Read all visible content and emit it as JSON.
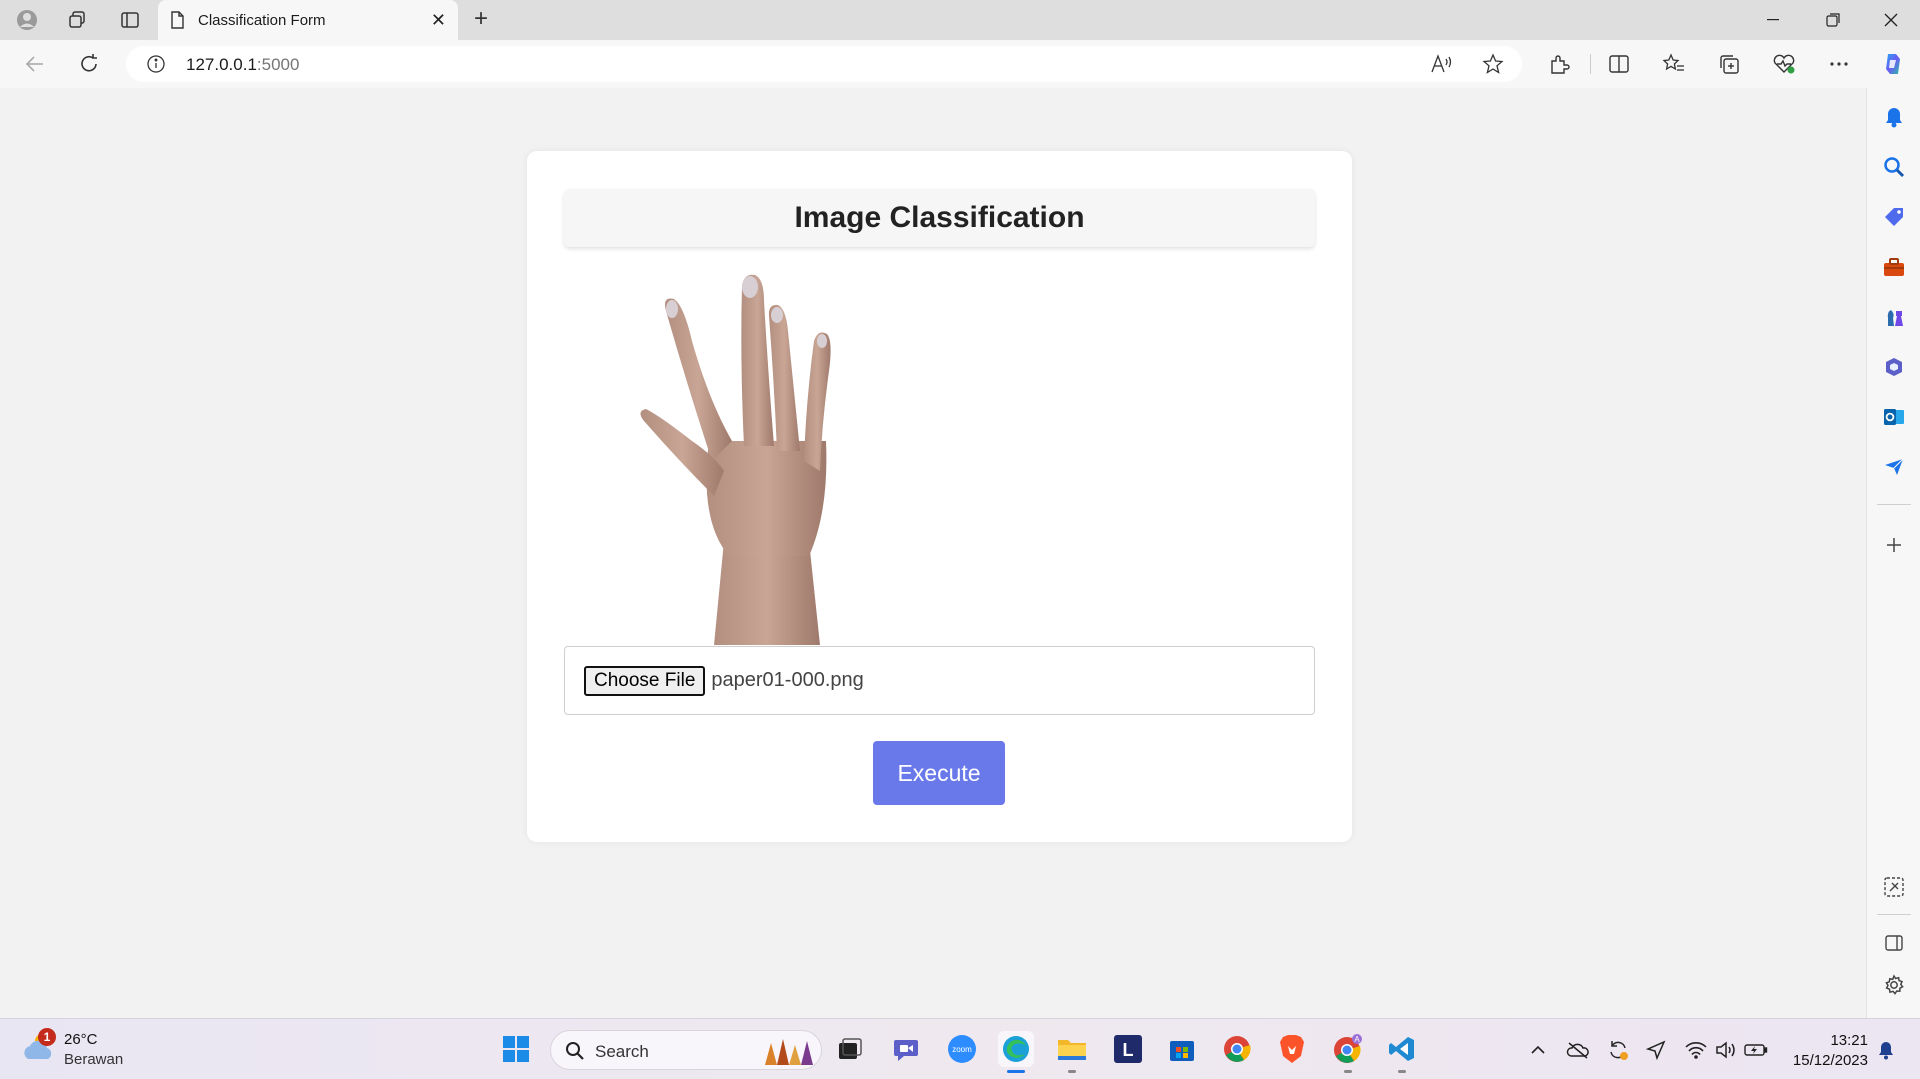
{
  "browser": {
    "tab_title": "Classification Form",
    "url_host": "127.0.0.1",
    "url_port": ":5000"
  },
  "page": {
    "title": "Image Classification",
    "choose_file_label": "Choose File",
    "file_name": "paper01-000.png",
    "execute_label": "Execute",
    "accent_color": "#6a79ea"
  },
  "taskbar": {
    "weather_badge": "1",
    "weather_temp": "26°C",
    "weather_desc": "Berawan",
    "search_label": "Search",
    "time": "13:21",
    "date": "15/12/2023"
  }
}
